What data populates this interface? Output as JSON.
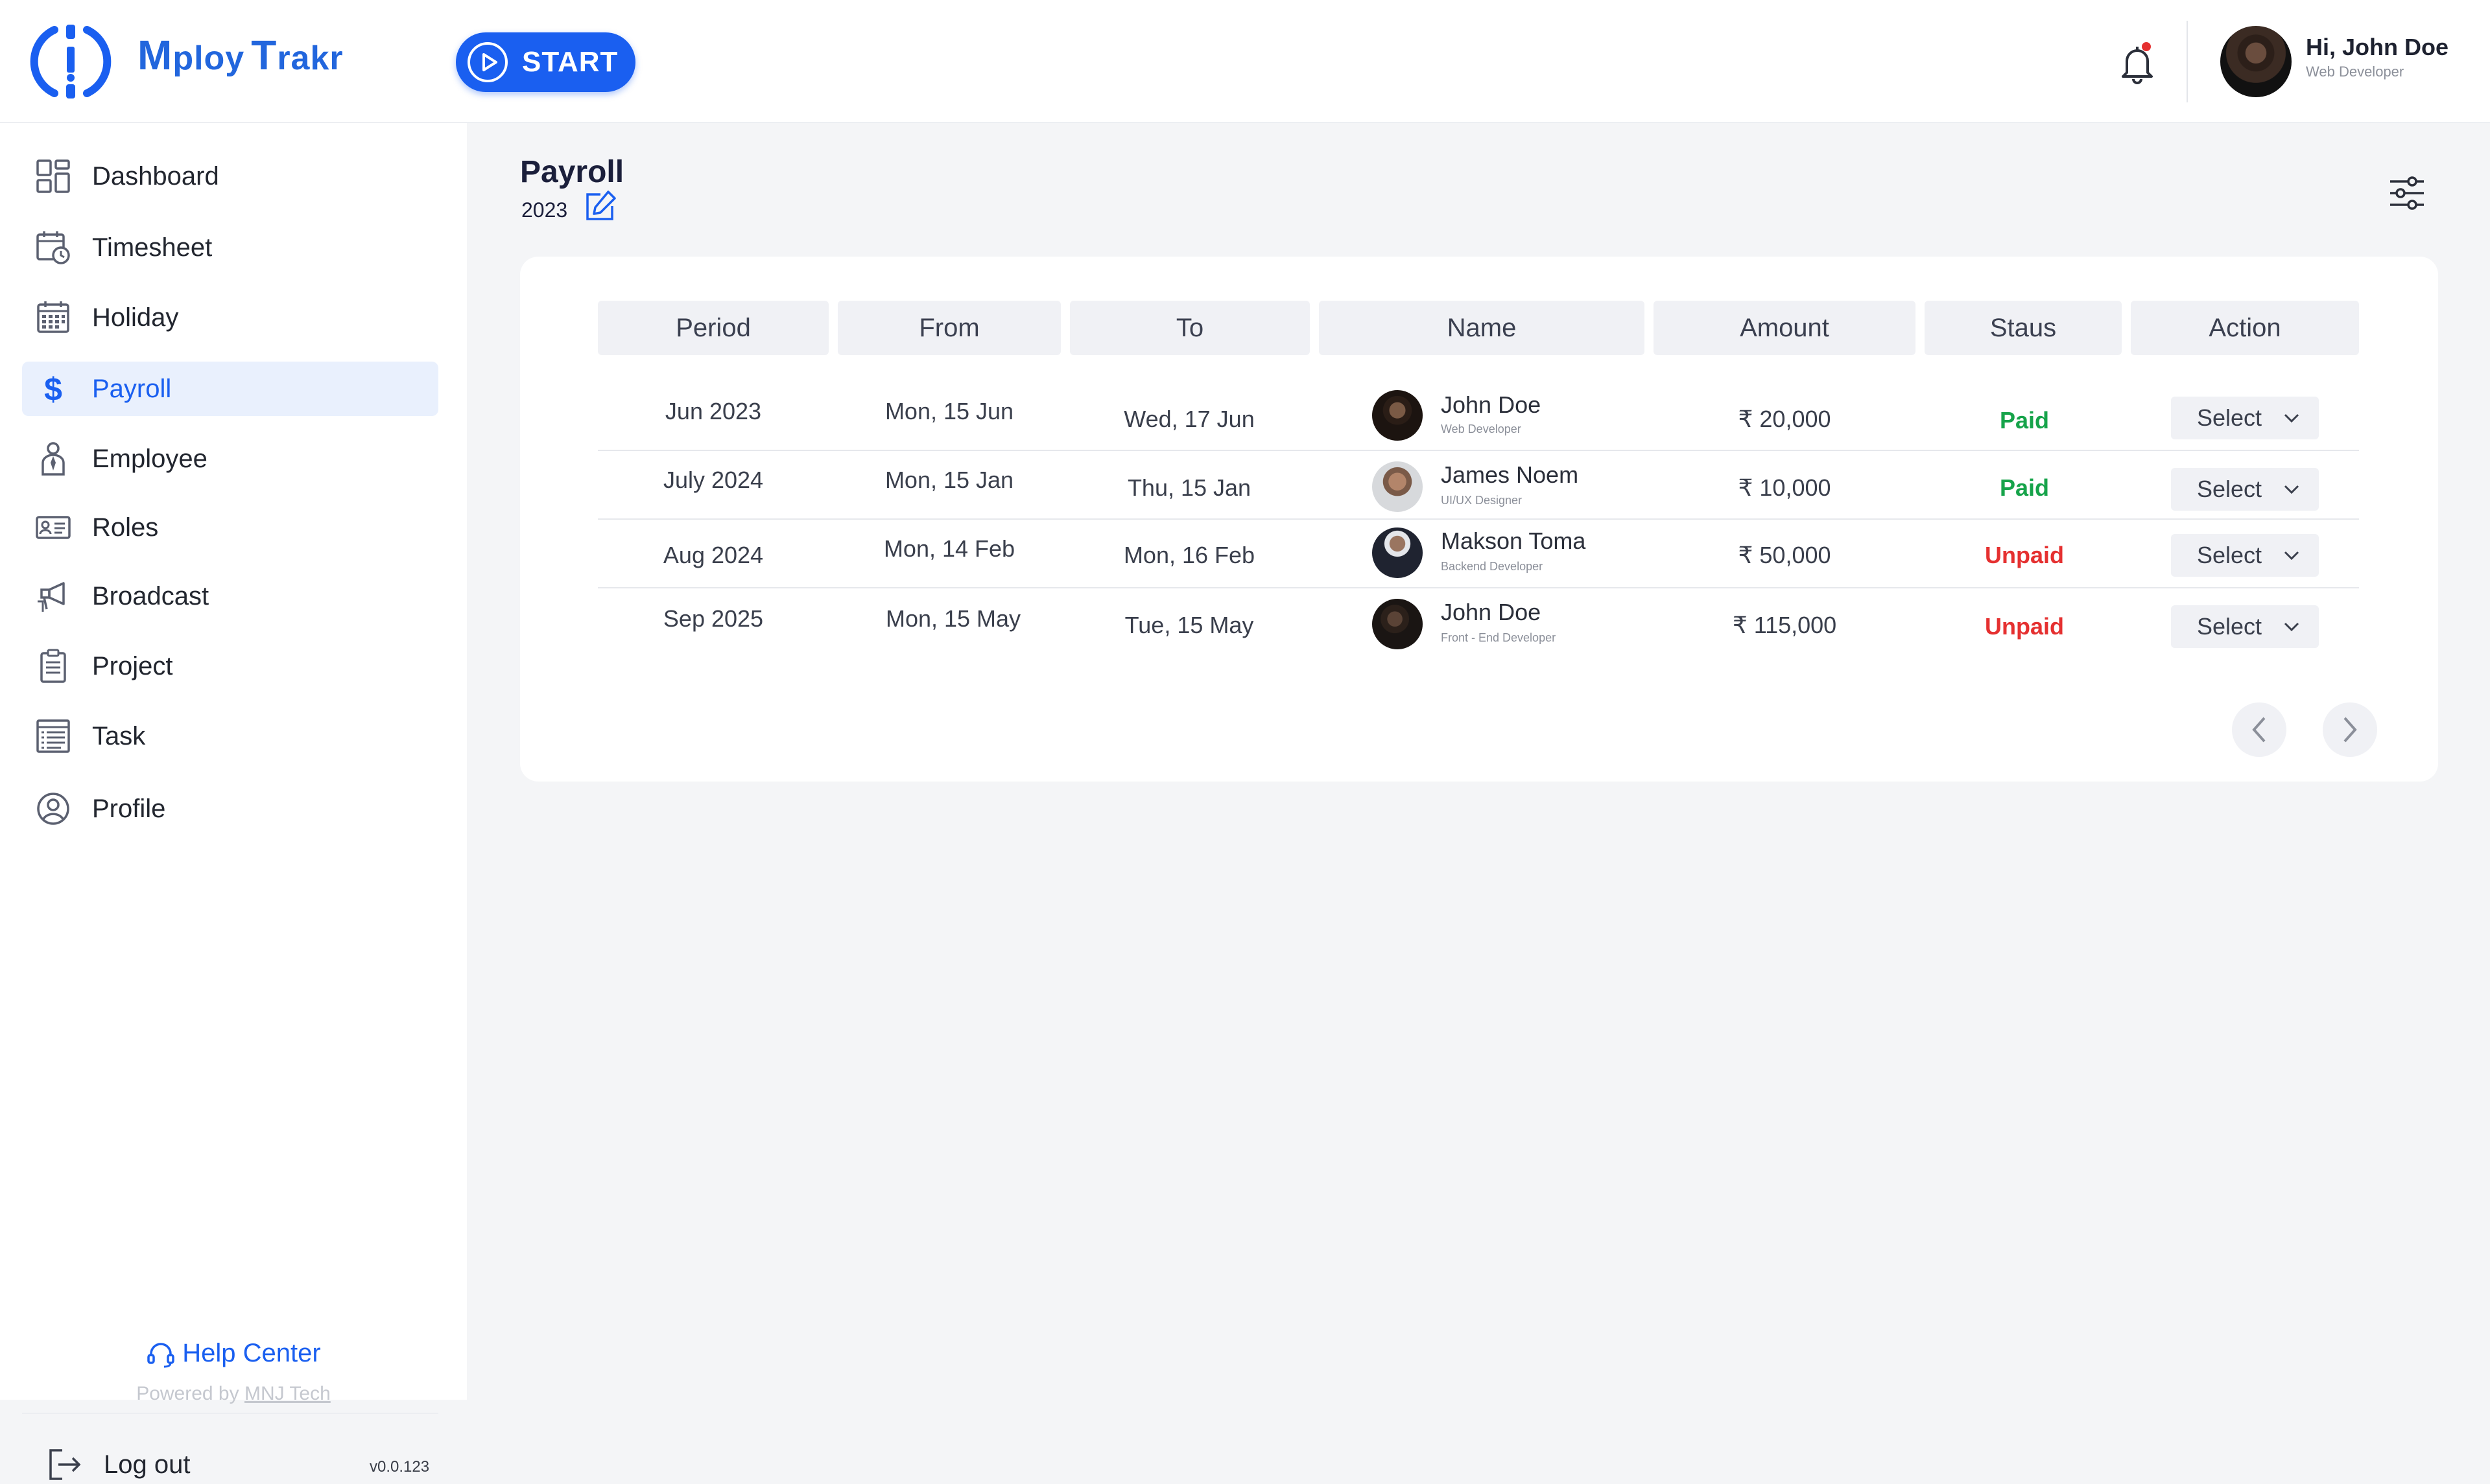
{
  "header": {
    "brand": {
      "letter1": "M",
      "part1": "ploy",
      "letter2": "T",
      "part2": "rakr"
    },
    "start_label": "START",
    "user": {
      "greeting": "Hi, John Doe",
      "role": "Web Developer"
    }
  },
  "sidebar": {
    "items": [
      {
        "id": "dashboard",
        "label": "Dashboard",
        "icon": "dashboard-icon"
      },
      {
        "id": "timesheet",
        "label": "Timesheet",
        "icon": "calendar-clock-icon"
      },
      {
        "id": "holiday",
        "label": "Holiday",
        "icon": "calendar-grid-icon"
      },
      {
        "id": "payroll",
        "label": "Payroll",
        "icon": "dollar-icon",
        "active": true
      },
      {
        "id": "employee",
        "label": "Employee",
        "icon": "employee-icon"
      },
      {
        "id": "roles",
        "label": "Roles",
        "icon": "id-card-icon"
      },
      {
        "id": "broadcast",
        "label": "Broadcast",
        "icon": "broadcast-icon"
      },
      {
        "id": "project",
        "label": "Project",
        "icon": "clipboard-icon"
      },
      {
        "id": "task",
        "label": "Task",
        "icon": "task-list-icon"
      },
      {
        "id": "profile",
        "label": "Profile",
        "icon": "user-circle-icon"
      }
    ],
    "help_label": "Help Center",
    "powered_prefix": "Powered by",
    "powered_link": "MNJ Tech",
    "logout_label": "Log out",
    "version": "v0.0.123"
  },
  "page": {
    "title": "Payroll",
    "year": "2023"
  },
  "table": {
    "columns": [
      "Period",
      "From",
      "To",
      "Name",
      "Amount",
      "Staus",
      "Action"
    ],
    "rows": [
      {
        "period": "Jun 2023",
        "from": "Mon, 15 Jun",
        "to": "Wed, 17 Jun",
        "name": "John Doe",
        "role": "Web Developer",
        "amount": "₹ 20,000",
        "status": "Paid",
        "action": "Select"
      },
      {
        "period": "July 2024",
        "from": "Mon, 15 Jan",
        "to": "Thu, 15 Jan",
        "name": "James Noem",
        "role": "UI/UX Designer",
        "amount": "₹ 10,000",
        "status": "Paid",
        "action": "Select"
      },
      {
        "period": "Aug 2024",
        "from": "Mon, 14 Feb",
        "to": "Mon, 16 Feb",
        "name": "Makson Toma",
        "role": "Backend Developer",
        "amount": "₹ 50,000",
        "status": "Unpaid",
        "action": "Select"
      },
      {
        "period": "Sep 2025",
        "from": "Mon, 15 May",
        "to": "Tue, 15 May",
        "name": "John Doe",
        "role": "Front - End Developer",
        "amount": "₹ 115,000",
        "status": "Unpaid",
        "action": "Select"
      }
    ]
  },
  "colors": {
    "accent": "#1a5ff0",
    "paid": "#16a34a",
    "unpaid": "#e53030",
    "active_bg": "#e9f0fd"
  }
}
